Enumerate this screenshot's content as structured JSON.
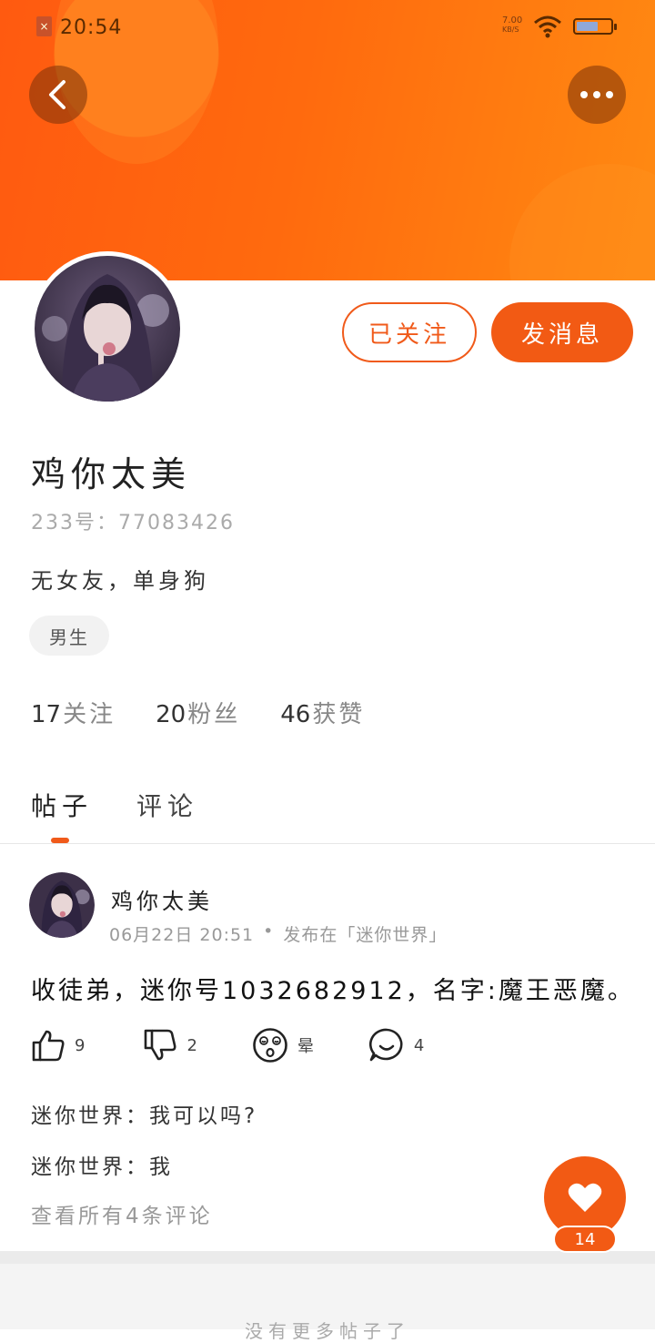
{
  "status_bar": {
    "time": "20:54",
    "net_speed_top": "7.00",
    "net_speed_unit": "KB/S",
    "battery_level": 0.65,
    "icons": [
      "sim-alert-icon",
      "wifi-icon",
      "battery-icon"
    ]
  },
  "header": {
    "back_icon": "chevron-left-icon",
    "more_icon": "more-dots-icon",
    "accent_color": "#f25a14"
  },
  "profile": {
    "name": "鸡你太美",
    "id_label": "233号：",
    "id_value": "77083426",
    "bio": "无女友，单身狗",
    "gender_tag": "男生",
    "followed_label": "已关注",
    "message_label": "发消息",
    "stats": [
      {
        "num": "17",
        "label": "关注"
      },
      {
        "num": "20",
        "label": "粉丝"
      },
      {
        "num": "46",
        "label": "获赞"
      }
    ]
  },
  "tabs": [
    {
      "label": "帖子",
      "active": true
    },
    {
      "label": "评论",
      "active": false
    }
  ],
  "post": {
    "author": "鸡你太美",
    "date": "06月22日 20:51",
    "dot": "•",
    "published_in": "发布在「迷你世界」",
    "content": "收徒弟，迷你号1032682912，名字:魔王恶魔。",
    "actions": [
      {
        "icon": "thumbs-up-icon",
        "count": "9"
      },
      {
        "icon": "thumbs-down-icon",
        "count": "2"
      },
      {
        "icon": "dizzy-face-icon",
        "count": "晕"
      },
      {
        "icon": "comment-bubble-icon",
        "count": "4"
      }
    ],
    "comments": [
      {
        "author": "迷你世界：",
        "text": "我可以吗?"
      },
      {
        "author": "迷你世界：",
        "text": "我"
      }
    ],
    "view_all": "查看所有4条评论"
  },
  "like_fab": {
    "icon": "heart-icon",
    "count": "14"
  },
  "footer": {
    "text": "没有更多帖子了"
  }
}
